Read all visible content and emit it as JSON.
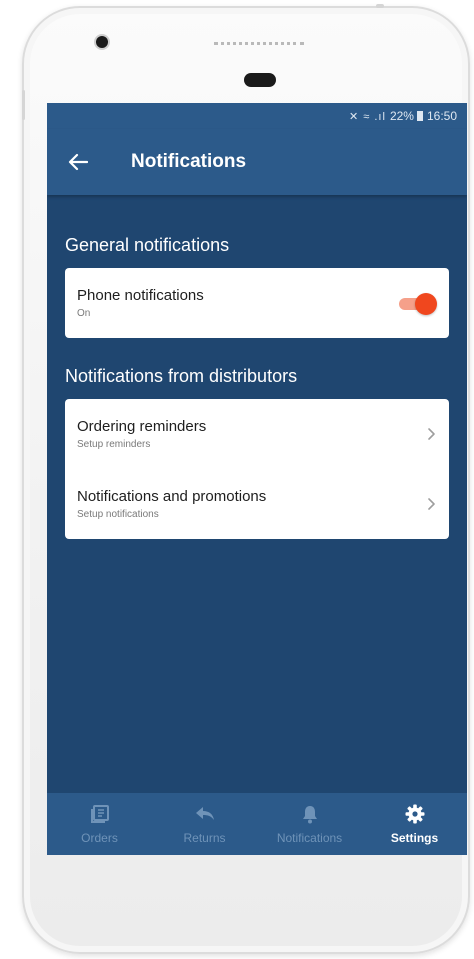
{
  "status_bar": {
    "icons": "✕ ≈ .ıl",
    "battery": "22%",
    "time": "16:50"
  },
  "app_bar": {
    "back_icon": "arrow-left-icon",
    "title": "Notifications"
  },
  "general": {
    "section_title": "General notifications",
    "phone_notifications": {
      "title": "Phone notifications",
      "subtitle": "On",
      "enabled": true
    }
  },
  "distributors": {
    "section_title": "Notifications from distributors",
    "items": [
      {
        "title": "Ordering reminders",
        "subtitle": "Setup reminders"
      },
      {
        "title": "Notifications and promotions",
        "subtitle": "Setup notifications"
      }
    ]
  },
  "bottom_nav": {
    "items": [
      {
        "label": "Orders",
        "icon": "orders-icon",
        "active": false
      },
      {
        "label": "Returns",
        "icon": "returns-icon",
        "active": false
      },
      {
        "label": "Notifications",
        "icon": "bell-icon",
        "active": false
      },
      {
        "label": "Settings",
        "icon": "gear-icon",
        "active": true
      }
    ]
  },
  "colors": {
    "primary": "#2c5a8a",
    "background": "#1f4670",
    "accent": "#f0471e",
    "nav_inactive": "#6f93b8"
  }
}
